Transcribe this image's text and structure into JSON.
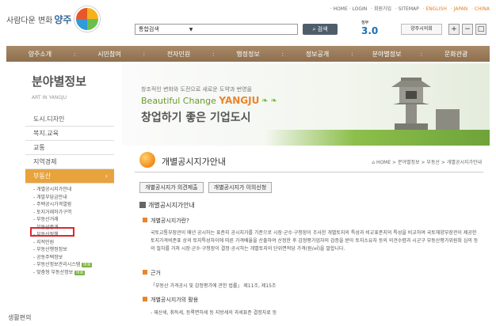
{
  "header": {
    "logo_text": "사람다운 변화",
    "logo_city": "양주",
    "toplinks": [
      {
        "label": "· HOME · LOGIN",
        "accent": false
      },
      {
        "label": "· 회원가입",
        "accent": false
      },
      {
        "label": "· SITEMAP",
        "accent": false
      },
      {
        "label": "· ENGLISH",
        "accent": true
      },
      {
        "label": "· JAPAN",
        "accent": true
      },
      {
        "label": "· CHINA",
        "accent": true
      }
    ],
    "search_select": "통합검색",
    "search_button": "검색",
    "badge_main": "3.0",
    "badge_sub": "정부",
    "council": "양주시의회",
    "ctrl_plus": "+",
    "ctrl_minus": "−",
    "ctrl_box": "□"
  },
  "nav": [
    "양주소개",
    "시민참여",
    "전자민원",
    "행정정보",
    "정보공개",
    "분야별정보",
    "문화관광"
  ],
  "sidebar": {
    "title": "분야별정보",
    "subtitle": "ART IN YANGJU",
    "items": [
      "도시.디자인",
      "복지.교육",
      "교통",
      "지역경제"
    ],
    "active": "부동산",
    "subitems": [
      {
        "label": "- 개별공시지가안내",
        "badge": ""
      },
      {
        "label": "- 개발부담금안내",
        "badge": ""
      },
      {
        "label": "- 주택공시가격열람",
        "badge": ""
      },
      {
        "label": "- 토지거래허가구역",
        "badge": ""
      },
      {
        "label": "- 부동산거래",
        "badge": ""
      },
      {
        "label": "- 부동산중개",
        "badge": ""
      },
      {
        "label": "- 부동산정책",
        "badge": ""
      },
      {
        "label": "- 지적민원",
        "badge": ""
      },
      {
        "label": "- 부동산행정정보",
        "badge": ""
      },
      {
        "label": "- 공동주택정보",
        "badge": ""
      },
      {
        "label": "- 부동산정보관리시스템",
        "badge": "바로"
      },
      {
        "label": "- 맞춤형 부동산정보",
        "badge": "바로"
      }
    ],
    "last_item": "생활편의"
  },
  "banner": {
    "line1": "창조적인 변화와 도전으로 새로운 도약과 번영을",
    "line2_prefix": "Beautiful Change",
    "line2_city": "YANGJU",
    "line3": "창업하기 좋은 기업도시"
  },
  "content": {
    "title": "개별공시지가안내",
    "breadcrumb": "⌂ HOME > 분야별정보 > 부동산 > 개별공시지가안내",
    "tabs": [
      "개별공시지가 의견제출",
      "개별공시지가 이의신청"
    ],
    "section_title": "개별공시지가안내",
    "sub1": "개별공시지가란?",
    "para1": "국토교통부장관이 매년 공시하는 표준지 공시지가를 기준으로 시장·군수·구청장이 조사한 개별토지의 특성과 비교표준지의 특성을 비교하여 국토해양부장관이 제공한 토지가격비준표 상의 토지특성차이에 따른 가격배율을 산출하여 산정한 후 감정평가업자의 검증을 받아 토지소유자 등의 의견수렴과 시군구 부동산평가위원회 심의 등의 절차를 거쳐 시장·군수·구청장이 결정·공시하는 개별토지의 단위면적당 가격(원/㎡)을 말합니다.",
    "sub2": "근거",
    "para2": "「부동산 가격공시 및 감정평가에 관한 법률」 제11조, 제15조",
    "sub3": "개별공시지가의 활용",
    "para3": "- 재산세, 취득세, 등록면허세 등 지방세의 과세표준 결정자료 등"
  }
}
